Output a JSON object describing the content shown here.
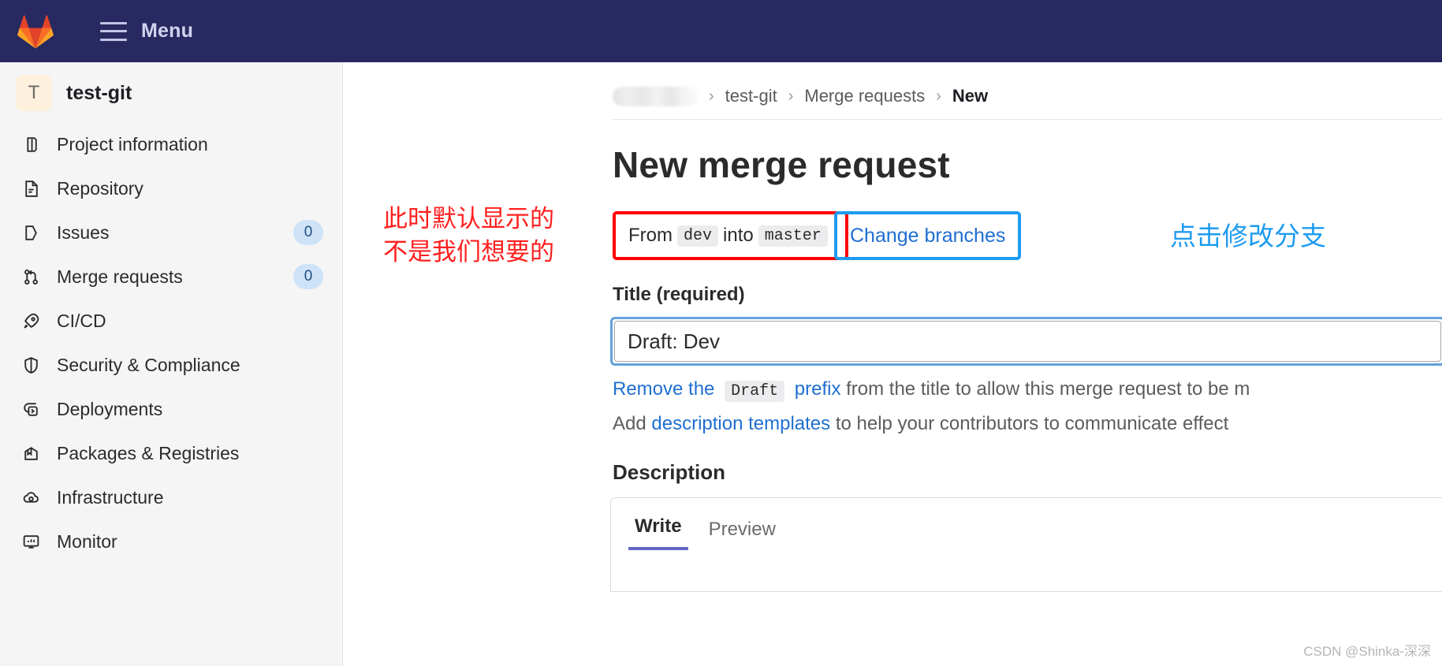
{
  "topbar": {
    "logo_icon": "gitlab-logo-icon",
    "menu_icon": "hamburger-menu-icon",
    "menu_label": "Menu"
  },
  "sidebar": {
    "project": {
      "avatar_letter": "T",
      "name": "test-git"
    },
    "items": [
      {
        "label": "Project information",
        "icon": "project-information-icon",
        "badge": ""
      },
      {
        "label": "Repository",
        "icon": "repository-icon",
        "badge": ""
      },
      {
        "label": "Issues",
        "icon": "issues-icon",
        "badge": "0"
      },
      {
        "label": "Merge requests",
        "icon": "merge-requests-icon",
        "badge": "0"
      },
      {
        "label": "CI/CD",
        "icon": "rocket-icon",
        "badge": ""
      },
      {
        "label": "Security & Compliance",
        "icon": "shield-icon",
        "badge": ""
      },
      {
        "label": "Deployments",
        "icon": "deployments-icon",
        "badge": ""
      },
      {
        "label": "Packages & Registries",
        "icon": "package-icon",
        "badge": ""
      },
      {
        "label": "Infrastructure",
        "icon": "infrastructure-cloud-icon",
        "badge": ""
      },
      {
        "label": "Monitor",
        "icon": "monitor-icon",
        "badge": ""
      }
    ]
  },
  "breadcrumb": {
    "redacted_item": "",
    "separator": "›",
    "project": "test-git",
    "section": "Merge requests",
    "current": "New"
  },
  "main": {
    "page_title": "New merge request",
    "branch": {
      "from_label": "From",
      "source": "dev",
      "into_label": "into",
      "target": "master",
      "change_branches_label": "Change branches"
    },
    "title_field": {
      "label": "Title (required)",
      "value": "Draft: Dev",
      "placeholder": ""
    },
    "help": {
      "line1_prefix": "Remove the",
      "line1_code": "Draft",
      "line1_link_tail": "prefix",
      "line1_rest": "from the title to allow this merge request to be m",
      "line2_prefix": "Add",
      "line2_link": "description templates",
      "line2_rest": "to help your contributors to communicate effect"
    },
    "description": {
      "label": "Description",
      "tabs": [
        {
          "label": "Write",
          "active": true
        },
        {
          "label": "Preview",
          "active": false
        }
      ]
    }
  },
  "annotations": {
    "left_line1": "此时默认显示的",
    "left_line2": "不是我们想要的",
    "right": "点击修改分支",
    "red_color": "#ff0000",
    "blue_color": "#1d9bf0"
  },
  "watermark": {
    "text": "CSDN @Shinka-深深"
  }
}
